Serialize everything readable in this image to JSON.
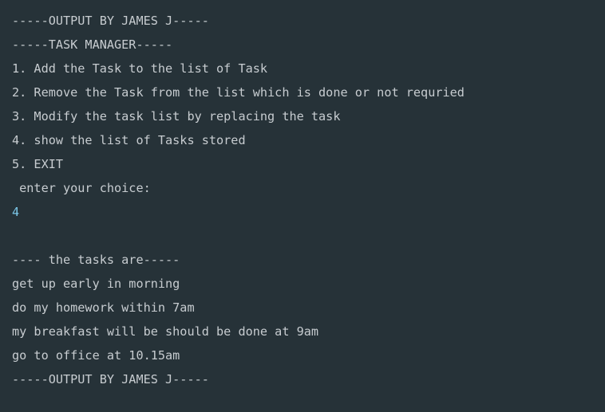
{
  "console": {
    "lines": [
      {
        "text": "-----OUTPUT BY JAMES J-----",
        "kind": "output"
      },
      {
        "text": "-----TASK MANAGER-----",
        "kind": "output"
      },
      {
        "text": "1. Add the Task to the list of Task",
        "kind": "output"
      },
      {
        "text": "2. Remove the Task from the list which is done or not requried",
        "kind": "output"
      },
      {
        "text": "3. Modify the task list by replacing the task",
        "kind": "output"
      },
      {
        "text": "4. show the list of Tasks stored",
        "kind": "output"
      },
      {
        "text": "5. EXIT",
        "kind": "output"
      },
      {
        "text": " enter your choice:",
        "kind": "output"
      },
      {
        "text": "4",
        "kind": "input"
      },
      {
        "text": "",
        "kind": "output"
      },
      {
        "text": "---- the tasks are-----",
        "kind": "output"
      },
      {
        "text": "get up early in morning",
        "kind": "output"
      },
      {
        "text": "do my homework within 7am",
        "kind": "output"
      },
      {
        "text": "my breakfast will be should be done at 9am",
        "kind": "output"
      },
      {
        "text": "go to office at 10.15am",
        "kind": "output"
      },
      {
        "text": "-----OUTPUT BY JAMES J-----",
        "kind": "output"
      }
    ]
  },
  "colors": {
    "background": "#263238",
    "output_text": "#c7ccd0",
    "input_text": "#7cc7e8"
  }
}
